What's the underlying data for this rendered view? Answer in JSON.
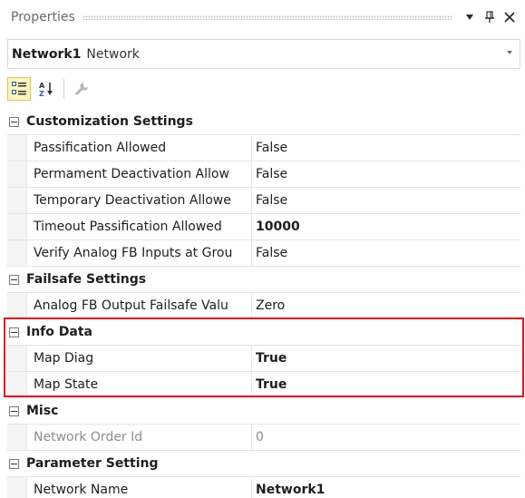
{
  "panel": {
    "title": "Properties"
  },
  "selector": {
    "name": "Network1",
    "type": "Network"
  },
  "toolbar": {
    "categorized_icon": "categorized-icon",
    "alphabetical_icon": "sort-alphabetical-icon",
    "property_pages_icon": "wrench-icon"
  },
  "categories": [
    {
      "label": "Customization Settings",
      "props": [
        {
          "name": "Passification Allowed",
          "value": "False"
        },
        {
          "name": "Permament Deactivation Allow",
          "value": "False"
        },
        {
          "name": "Temporary Deactivation Allowe",
          "value": "False"
        },
        {
          "name": "Timeout Passification Allowed",
          "value": "10000"
        },
        {
          "name": "Verify Analog FB Inputs at Grou",
          "value": "False"
        }
      ]
    },
    {
      "label": "Failsafe Settings",
      "props": [
        {
          "name": "Analog FB Output Failsafe Valu",
          "value": "Zero"
        }
      ]
    },
    {
      "label": "Info Data",
      "props": [
        {
          "name": "Map Diag",
          "value": "True"
        },
        {
          "name": "Map State",
          "value": "True"
        }
      ]
    },
    {
      "label": "Misc",
      "props": [
        {
          "name": "Network Order Id",
          "value": "0"
        }
      ]
    },
    {
      "label": "Parameter Setting",
      "props": [
        {
          "name": "Network Name",
          "value": "Network1"
        }
      ]
    }
  ],
  "colors": {
    "highlight": "#e0141e",
    "active_button": "#fdf4bf"
  }
}
